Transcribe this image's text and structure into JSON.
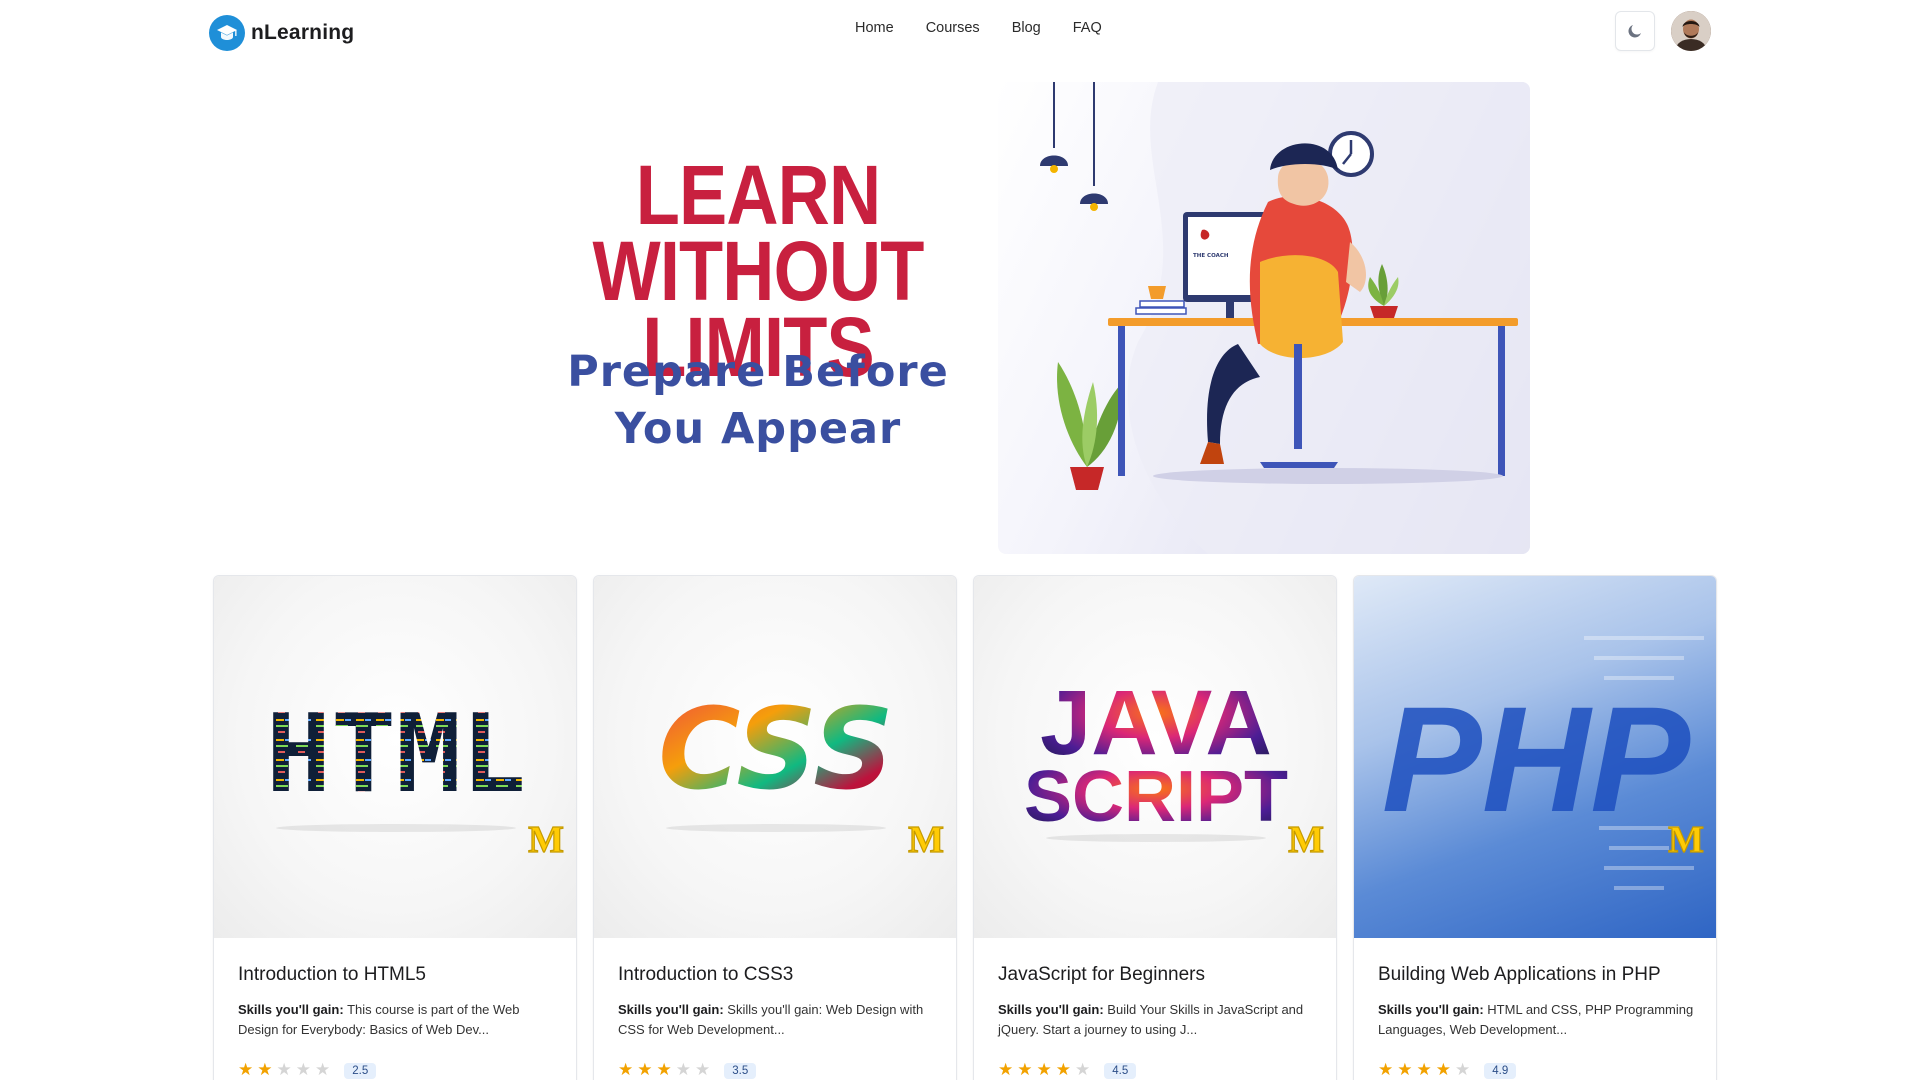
{
  "brand": {
    "name": "nLearning",
    "logo_icon": "graduation-cap-icon",
    "logo_color": "#1f8fd8"
  },
  "nav": {
    "links": [
      {
        "label": "Home"
      },
      {
        "label": "Courses"
      },
      {
        "label": "Blog"
      },
      {
        "label": "FAQ"
      }
    ],
    "theme_toggle_icon": "moon-icon",
    "avatar_icon": "user-avatar"
  },
  "hero": {
    "headline_line1": "LEARN WITHOUT",
    "headline_line2": "LIMITS",
    "sub_line1": "Prepare Before",
    "sub_line2": "You Appear",
    "headline_color": "#c8203f",
    "sub_color": "#3a4fa0",
    "monitor_logo_text": "THE COACH"
  },
  "courses": [
    {
      "image_text": "HTML",
      "title": "Introduction to HTML5",
      "skills_label": "Skills you'll gain:",
      "skills_text": "This course is part of the Web Design for Everybody: Basics of Web Dev...",
      "stars": 2,
      "rating": "2.5",
      "badge_letter": "M"
    },
    {
      "image_text": "CSS",
      "title": "Introduction to CSS3",
      "skills_label": "Skills you'll gain:",
      "skills_text": "Skills you'll gain: Web Design with CSS for Web Development...",
      "stars": 3,
      "rating": "3.5",
      "badge_letter": "M"
    },
    {
      "image_text_line1": "JAVA",
      "image_text_line2": "SCRIPT",
      "title": "JavaScript for Beginners",
      "skills_label": "Skills you'll gain:",
      "skills_text": "Build Your Skills in JavaScript and jQuery. Start a journey to using J...",
      "stars": 4,
      "rating": "4.5",
      "badge_letter": "M"
    },
    {
      "image_text": "PHP",
      "title": "Building Web Applications in PHP",
      "skills_label": "Skills you'll gain:",
      "skills_text": "HTML and CSS, PHP Programming Languages, Web Development...",
      "stars": 4,
      "rating": "4.9",
      "badge_letter": "M"
    }
  ],
  "colors": {
    "star_on": "#f2a200",
    "star_off": "#d5d5d5",
    "badge_bg": "#e5effc"
  }
}
